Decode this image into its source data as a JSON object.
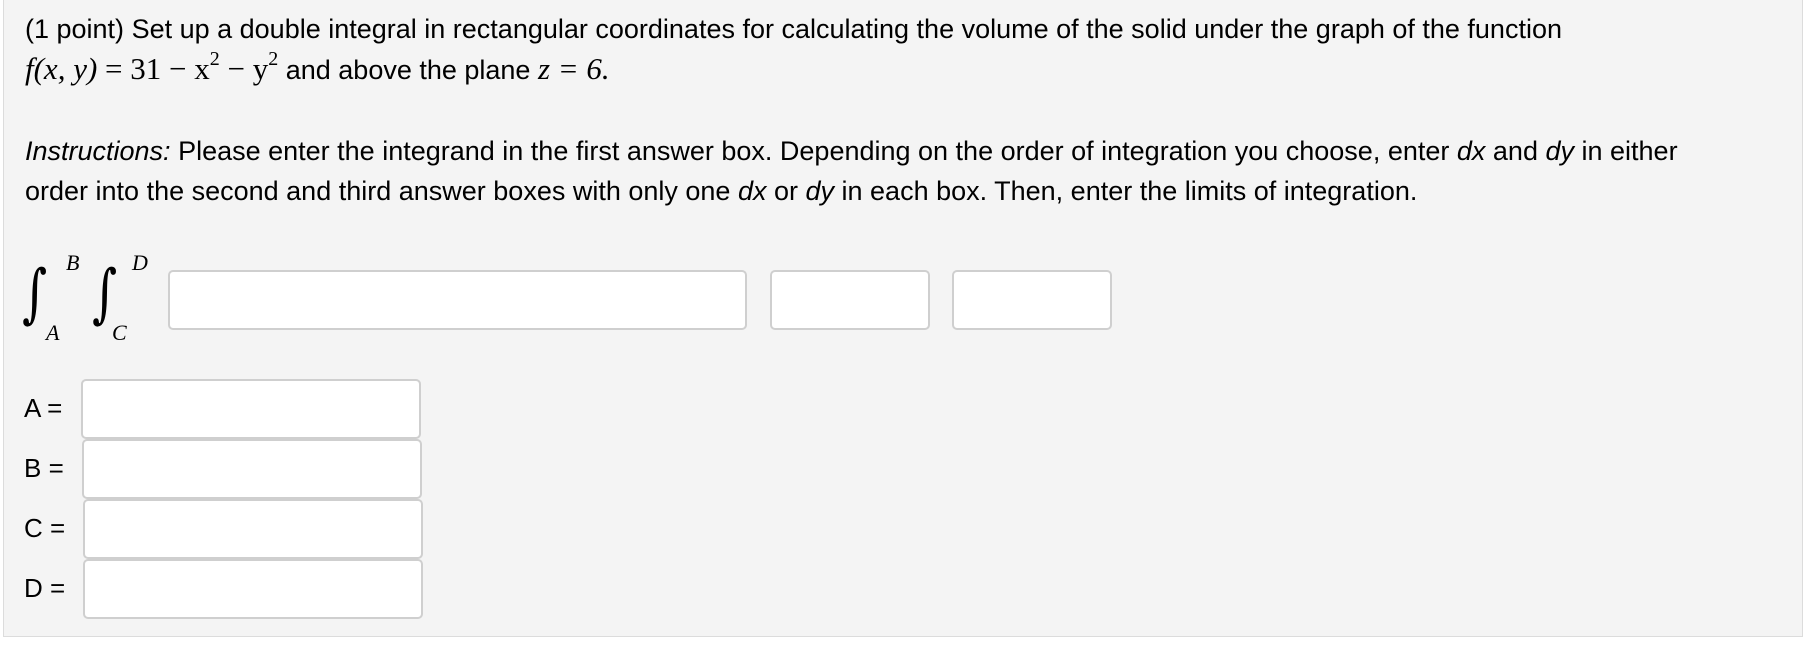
{
  "problem": {
    "points_label": "(1 point)",
    "statement_line1": " Set up a double integral in rectangular coordinates for calculating the volume of the solid under the graph of the function",
    "function_lhs": "f(x, y)",
    "function_eq": " = 31 − x",
    "function_exp1": "2",
    "function_minus": " − y",
    "function_exp2": "2",
    "and_above_text": " and above the plane ",
    "plane_eq": "z = 6."
  },
  "instructions": {
    "label": "Instructions:",
    "line1_a": " Please enter the integrand in the first answer box. Depending on the order of integration you choose, enter ",
    "dx": "dx",
    "line1_b": " and ",
    "dy": "dy",
    "line1_c": " in either",
    "line2_a": "order into the second and third answer boxes with only one ",
    "dx2": "dx",
    "line2_b": " or ",
    "dy2": "dy",
    "line2_c": " in each box. Then, enter the limits of integration."
  },
  "integral": {
    "outer_upper": "B",
    "outer_lower": "A",
    "inner_upper": "D",
    "inner_lower": "C",
    "sign": "∫"
  },
  "answers": {
    "integrand_value": "",
    "differential1_value": "",
    "differential2_value": ""
  },
  "limits": [
    {
      "label": "A =",
      "value": ""
    },
    {
      "label": "B =",
      "value": ""
    },
    {
      "label": "C =",
      "value": ""
    },
    {
      "label": "D =",
      "value": ""
    }
  ]
}
